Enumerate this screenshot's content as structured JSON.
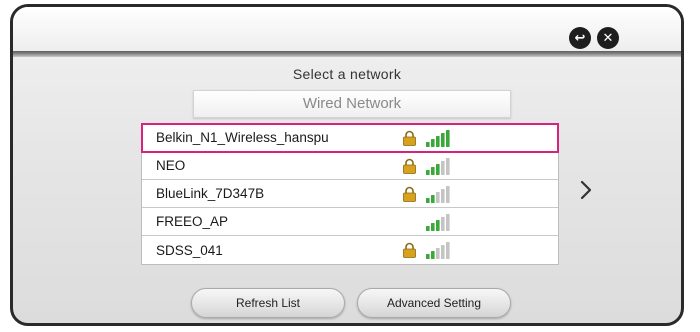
{
  "header": {
    "back_icon": "back-arrow-icon",
    "close_icon": "close-icon",
    "back_glyph": "↩",
    "close_glyph": "✕"
  },
  "title": "Select a network",
  "wired_network": {
    "label": "Wired Network"
  },
  "networks": [
    {
      "ssid": "Belkin_N1_Wireless_hanspu",
      "locked": true,
      "signal_bars": 5,
      "selected": true
    },
    {
      "ssid": "NEO",
      "locked": true,
      "signal_bars": 3,
      "selected": false
    },
    {
      "ssid": "BlueLink_7D347B",
      "locked": true,
      "signal_bars": 2,
      "selected": false
    },
    {
      "ssid": "FREEO_AP",
      "locked": false,
      "signal_bars": 3,
      "selected": false
    },
    {
      "ssid": "SDSS_041",
      "locked": true,
      "signal_bars": 2,
      "selected": false
    }
  ],
  "next_page_icon": "chevron-right-icon",
  "buttons": {
    "refresh_label": "Refresh List",
    "advanced_label": "Advanced Setting"
  },
  "colors": {
    "selection_border": "#d6237e",
    "signal_active": "#3aa93a",
    "signal_inactive": "#c4c4c4",
    "lock_body": "#d9a21c"
  }
}
